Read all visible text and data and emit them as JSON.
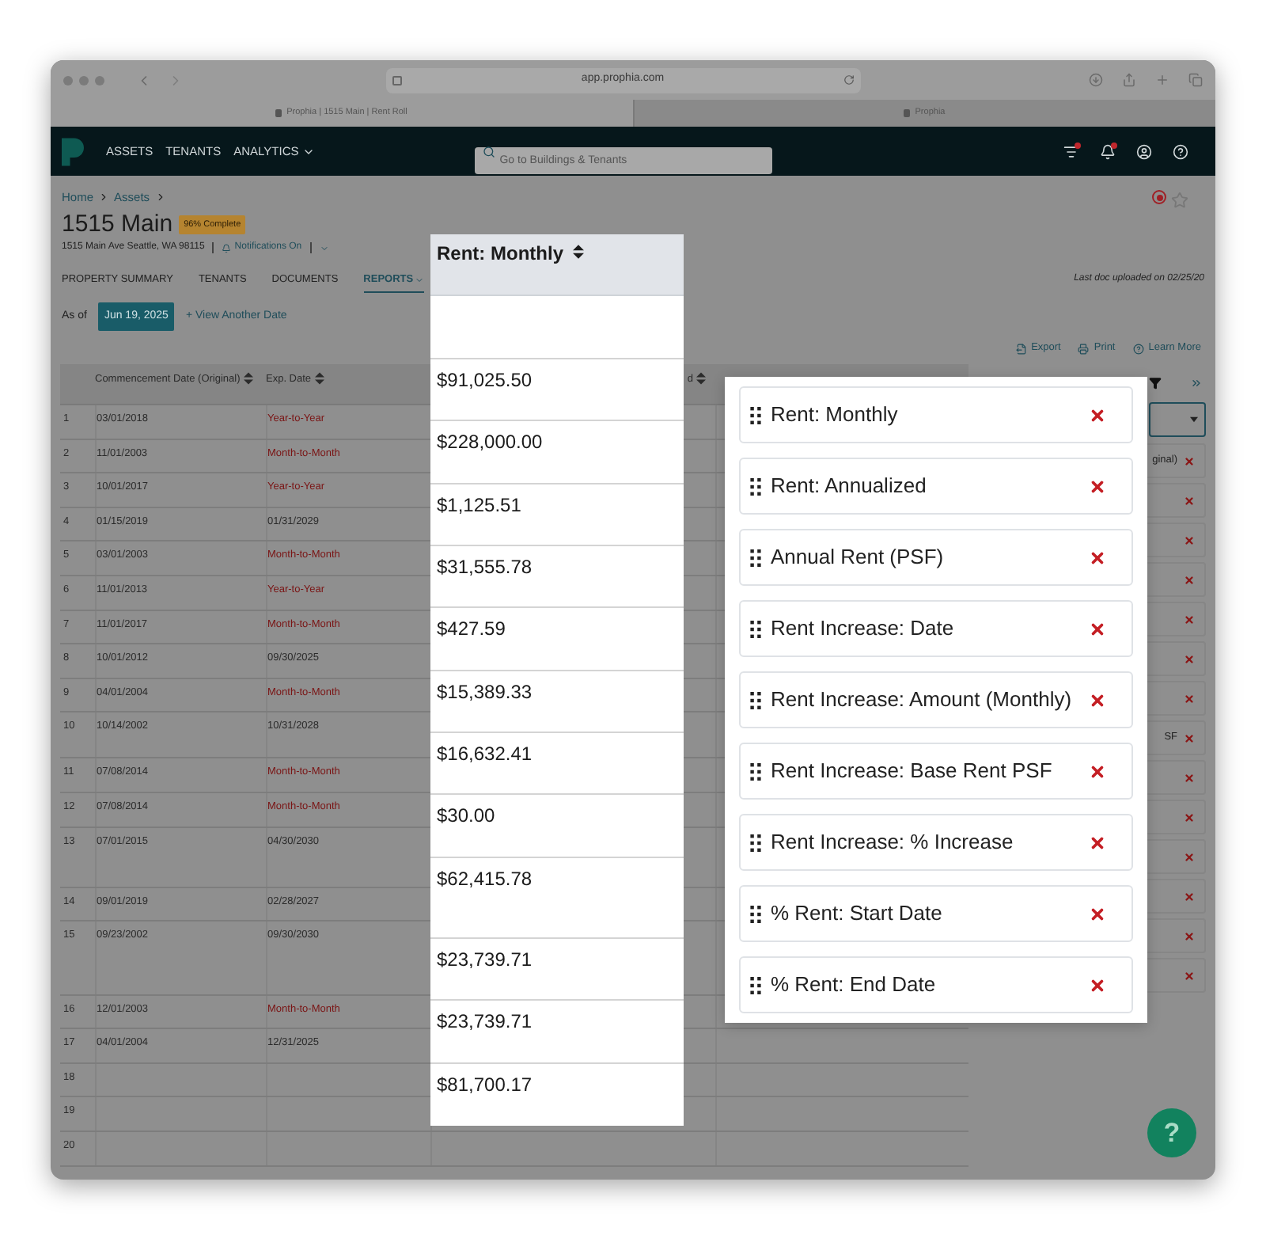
{
  "browser": {
    "url": "app.prophia.com",
    "tabs": [
      {
        "title": "Prophia | 1515 Main | Rent Roll",
        "selected": true
      },
      {
        "title": "Prophia",
        "selected": false
      }
    ]
  },
  "nav": {
    "items": [
      {
        "label": "ASSETS",
        "dropdown": false
      },
      {
        "label": "TENANTS",
        "dropdown": false
      },
      {
        "label": "ANALYTICS",
        "dropdown": true
      }
    ],
    "search": {
      "placeholder": "Go to Buildings & Tenants"
    }
  },
  "page": {
    "breadcrumb": [
      "Home",
      "Assets"
    ],
    "title": "1515 Main",
    "badge": "96% Complete",
    "address": "1515 Main Ave Seattle, WA 98115",
    "notifications": "Notifications On",
    "last_upload": "Last doc uploaded on 02/25/20",
    "as_of_label": "As of",
    "date": "Jun 19, 2025",
    "view_another": "+ View Another Date",
    "tabs": [
      {
        "label": "PROPERTY SUMMARY",
        "selected": false
      },
      {
        "label": "TENANTS",
        "selected": false
      },
      {
        "label": "DOCUMENTS",
        "selected": false
      },
      {
        "label": "REPORTS",
        "selected": true
      }
    ],
    "actions": [
      {
        "kind": "export",
        "label": "Export"
      },
      {
        "kind": "print",
        "label": "Print"
      },
      {
        "kind": "help",
        "label": "Learn More"
      }
    ]
  },
  "table": {
    "columns": [
      "Commencement Date (Original)",
      "Exp. Date",
      "d"
    ],
    "rows": [
      {
        "num": "1",
        "commencement": "03/01/2018",
        "expiration": "Year-to-Year",
        "flagged": true
      },
      {
        "num": "2",
        "commencement": "11/01/2003",
        "expiration": "Month-to-Month",
        "flagged": true
      },
      {
        "num": "3",
        "commencement": "10/01/2017",
        "expiration": "Year-to-Year",
        "flagged": true
      },
      {
        "num": "4",
        "commencement": "01/15/2019",
        "expiration": "01/31/2029",
        "flagged": false
      },
      {
        "num": "5",
        "commencement": "03/01/2003",
        "expiration": "Month-to-Month",
        "flagged": true
      },
      {
        "num": "6",
        "commencement": "11/01/2013",
        "expiration": "Year-to-Year",
        "flagged": true
      },
      {
        "num": "7",
        "commencement": "11/01/2017",
        "expiration": "Month-to-Month",
        "flagged": true
      },
      {
        "num": "8",
        "commencement": "10/01/2012",
        "expiration": "09/30/2025",
        "flagged": false
      },
      {
        "num": "9",
        "commencement": "04/01/2004",
        "expiration": "Month-to-Month",
        "flagged": true
      },
      {
        "num": "10",
        "commencement": "10/14/2002",
        "expiration": "10/31/2028",
        "flagged": false
      },
      {
        "num": "11",
        "commencement": "07/08/2014",
        "expiration": "Month-to-Month",
        "flagged": true
      },
      {
        "num": "12",
        "commencement": "07/08/2014",
        "expiration": "Month-to-Month",
        "flagged": true
      },
      {
        "num": "13",
        "commencement": "07/01/2015",
        "expiration": "04/30/2030",
        "flagged": false
      },
      {
        "num": "14",
        "commencement": "09/01/2019",
        "expiration": "02/28/2027",
        "flagged": false
      },
      {
        "num": "15",
        "commencement": "09/23/2002",
        "expiration": "09/30/2030",
        "flagged": false
      },
      {
        "num": "16",
        "commencement": "12/01/2003",
        "expiration": "Month-to-Month",
        "flagged": true
      },
      {
        "num": "17",
        "commencement": "04/01/2004",
        "expiration": "12/31/2025",
        "flagged": false
      },
      {
        "num": "18"
      },
      {
        "num": "19"
      },
      {
        "num": "20"
      }
    ]
  },
  "sidebar": {
    "chips": [
      {
        "label": "ginal)"
      },
      {
        "label": "SF"
      }
    ]
  },
  "highlighted_column": {
    "header": "Rent: Monthly",
    "values": [
      "$91,025.50",
      "$228,000.00",
      "$1,125.51",
      "$31,555.78",
      "$427.59",
      "$15,389.33",
      "$16,632.41",
      "$30.00",
      "$62,415.78",
      "$23,739.71",
      "$23,739.71",
      "$81,700.17"
    ]
  },
  "column_panel": {
    "items": [
      "Rent: Monthly",
      "Rent: Annualized",
      "Annual Rent (PSF)",
      "Rent Increase: Date",
      "Rent Increase: Amount (Monthly)",
      "Rent Increase: Base Rent PSF",
      "Rent Increase: % Increase",
      "% Rent: Start Date",
      "% Rent: End Date"
    ]
  },
  "help_button": "?"
}
